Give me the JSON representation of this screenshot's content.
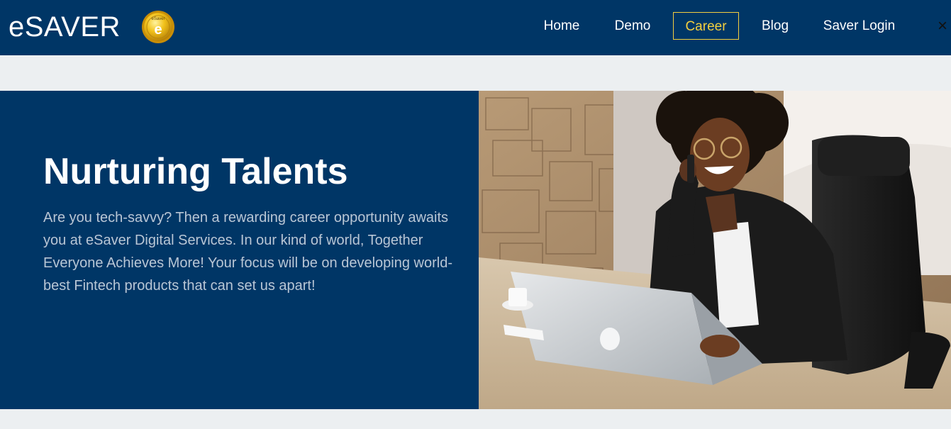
{
  "header": {
    "brand": "eSAVER",
    "logo_icon": "esaver-coin-logo",
    "logo_text": "eSaver",
    "logo_letter": "e",
    "nav": [
      {
        "label": "Home",
        "active": false
      },
      {
        "label": "Demo",
        "active": false
      },
      {
        "label": "Career",
        "active": true
      },
      {
        "label": "Blog",
        "active": false
      },
      {
        "label": "Saver Login",
        "active": false
      }
    ],
    "close_icon": "close-icon",
    "close_glyph": "×"
  },
  "hero": {
    "title": "Nurturing Talents",
    "text": "Are you tech-savvy? Then a rewarding career opportunity awaits you at eSaver Digital Services. In our kind of world, Together Everyone Achieves More! Your focus will be on developing world-best Fintech products that can set us apart!",
    "image_icon": "office-woman-laptop-photo"
  },
  "colors": {
    "navy": "#003666",
    "accent": "#f3cf3f",
    "page_bg": "#eceff1",
    "hero_text": "#b9c6d5"
  }
}
